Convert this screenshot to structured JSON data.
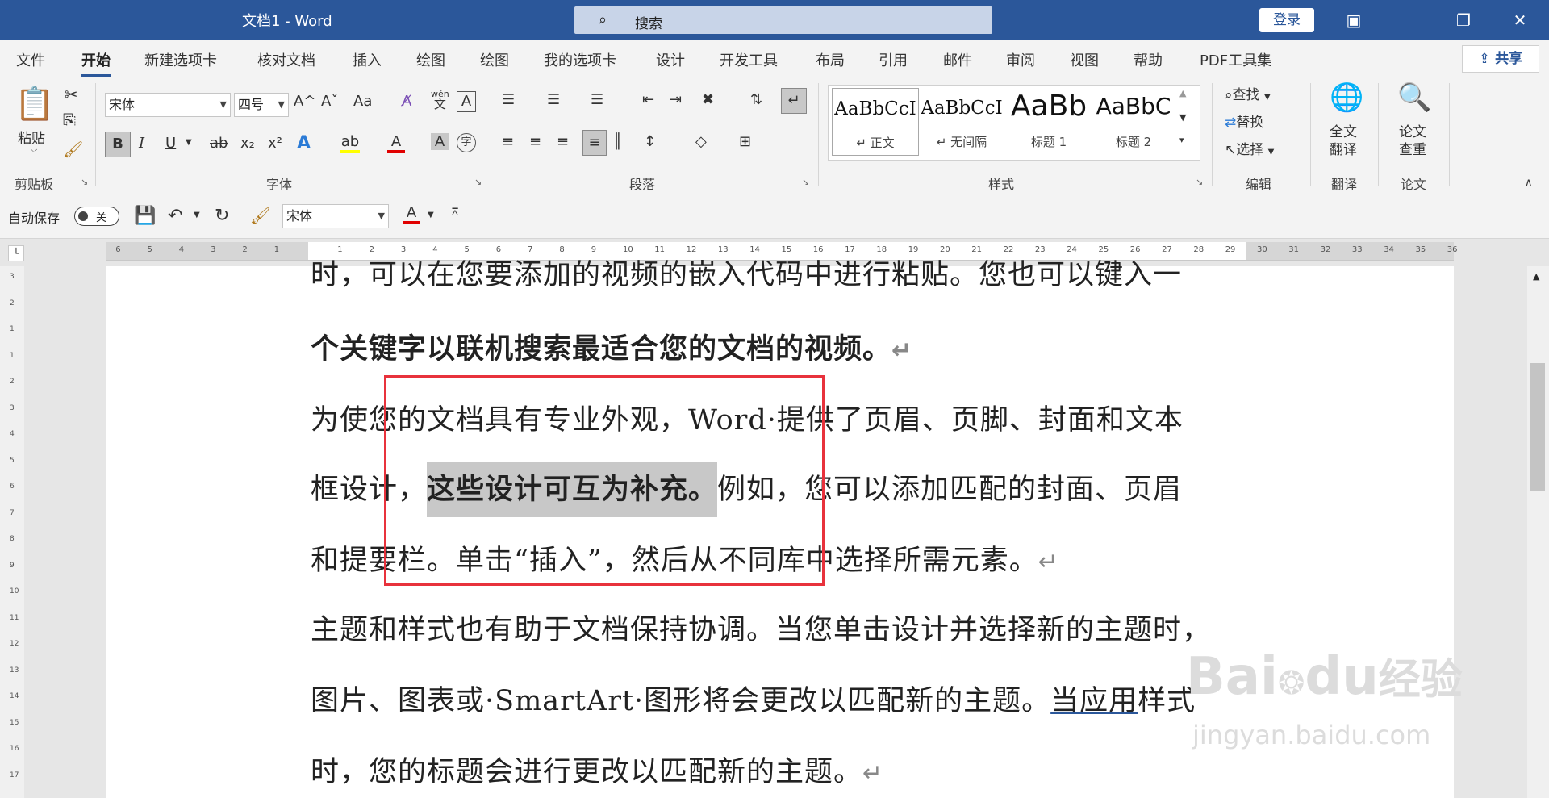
{
  "titlebar": {
    "title": "文档1  -  Word",
    "search_placeholder": "搜索",
    "login_label": "登录",
    "accent": "#2b579a"
  },
  "tabs": [
    "文件",
    "开始",
    "新建选项卡",
    "核对文档",
    "插入",
    "绘图",
    "绘图",
    "我的选项卡",
    "设计",
    "开发工具",
    "布局",
    "引用",
    "邮件",
    "审阅",
    "视图",
    "帮助",
    "PDF工具集"
  ],
  "share_label": "共享",
  "ribbon": {
    "clipboard": {
      "paste_label": "粘贴",
      "group_label": "剪贴板"
    },
    "font": {
      "font_name": "宋体",
      "font_size": "四号",
      "group_label": "字体",
      "grow": "A^",
      "shrink": "Aˇ",
      "case": "Aa",
      "pinyin_top": "wén",
      "pinyin_bot": "文",
      "border": "A",
      "bold": "B",
      "italic": "I",
      "underline": "U",
      "strike": "ab",
      "sub": "x₂",
      "sup": "x²",
      "effects": "A",
      "highlight": "ab",
      "color": "A",
      "shade": "A",
      "enclose": "字"
    },
    "paragraph": {
      "group_label": "段落"
    },
    "styles": {
      "group_label": "样式",
      "items": [
        {
          "preview": "AaBbCcI",
          "name": "↵ 正文"
        },
        {
          "preview": "AaBbCcI",
          "name": "↵ 无间隔"
        },
        {
          "preview": "AaBb",
          "name": "标题 1"
        },
        {
          "preview": "AaBbC",
          "name": "标题 2"
        }
      ]
    },
    "editing": {
      "find_label": "查找",
      "replace_label": "替换",
      "select_label": "选择",
      "group_label": "编辑"
    },
    "translate": {
      "label_line1": "全文",
      "label_line2": "翻译",
      "group_label": "翻译"
    },
    "paper": {
      "label_line1": "论文",
      "label_line2": "查重",
      "group_label": "论文"
    }
  },
  "qat": {
    "autosave_label": "自动保存",
    "autosave_state": "关",
    "font_name": "宋体",
    "font_color_glyph": "A"
  },
  "ruler": {
    "numbers": [
      "6",
      "5",
      "4",
      "3",
      "2",
      "1",
      "1",
      "2",
      "3",
      "4",
      "5",
      "6",
      "7",
      "8",
      "9",
      "10",
      "11",
      "12",
      "13",
      "14",
      "15",
      "16",
      "17",
      "18",
      "19",
      "20",
      "21",
      "22",
      "23",
      "24",
      "25",
      "26",
      "27",
      "28",
      "29",
      "30",
      "31",
      "32",
      "33",
      "34",
      "35",
      "36"
    ]
  },
  "vruler": {
    "numbers": [
      "3",
      "2",
      "1",
      "1",
      "2",
      "3",
      "4",
      "5",
      "6",
      "7",
      "8",
      "9",
      "10",
      "11",
      "12",
      "13",
      "14",
      "15",
      "16",
      "17"
    ]
  },
  "document": {
    "line0": "时，可以在您要添加的视频的嵌入代码中进行粘贴。您也可以键入一",
    "line1": "个关键字以联机搜索最适合您的文档的视频。",
    "line2": "为使您的文档具有专业外观，Word·提供了页眉、页脚、封面和文本",
    "line3_pre": "框设计，",
    "line3_sel": "这些设计可互为补充。",
    "line3_post": "例如，您可以添加匹配的封面、页眉",
    "line4": "和提要栏。单击“插入”，然后从不同库中选择所需元素。",
    "line5": "主题和样式也有助于文档保持协调。当您单击设计并选择新的主题时，",
    "line6_pre": "图片、图表或·SmartArt·图形将会更改以匹配新的主题。",
    "line6_ul": "当应用",
    "line6_post": "样式",
    "line7": "时，您的标题会进行更改以匹配新的主题。",
    "para_mark": "↵"
  },
  "watermark": {
    "brand": "Bai",
    "brand2": "du",
    "site_cn": "经验",
    "url": "jingyan.baidu.com"
  },
  "highlight_color": "#e8323c"
}
